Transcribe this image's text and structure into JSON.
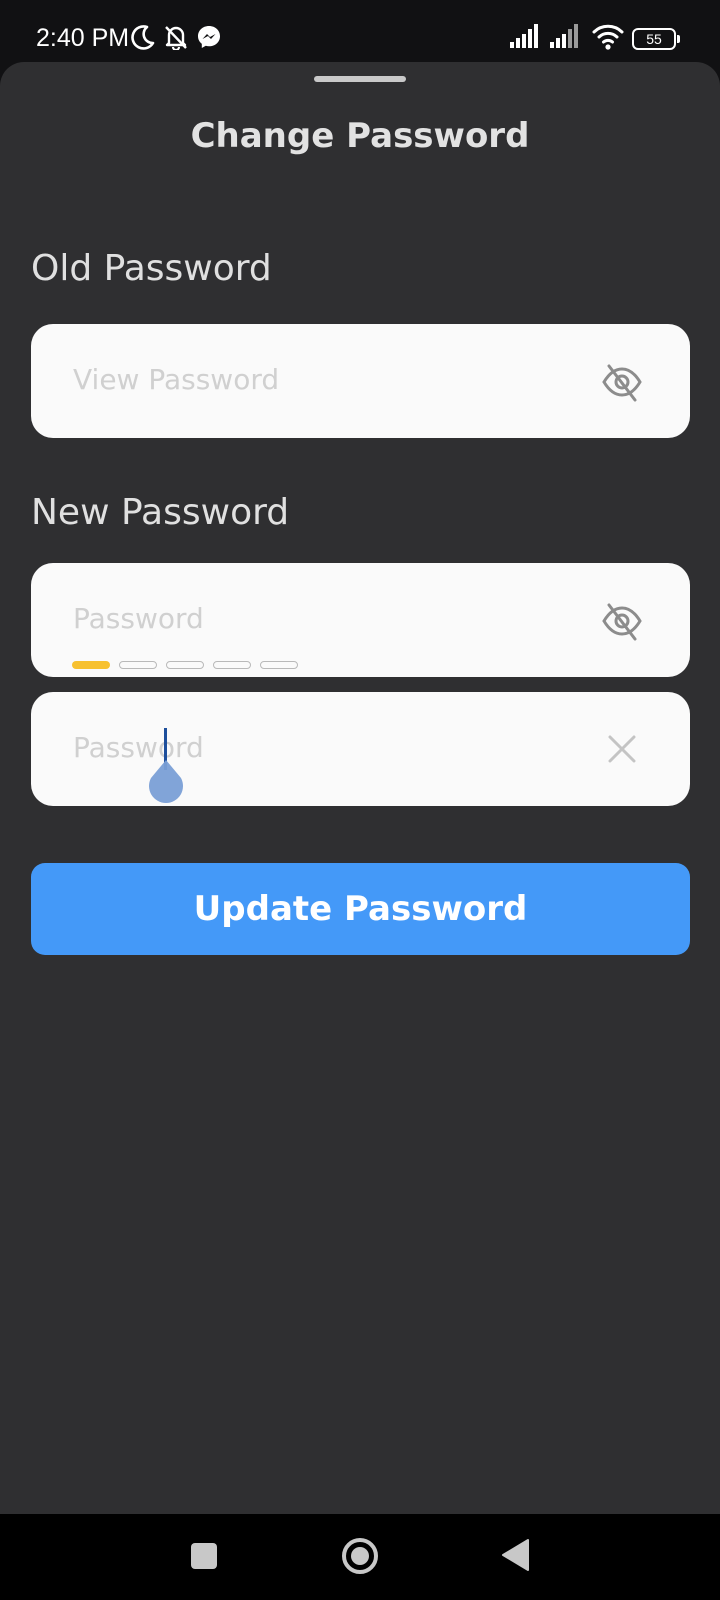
{
  "status_bar": {
    "time": "2:40 PM",
    "battery_level": "55",
    "icons": [
      "moon-icon",
      "bell-off-icon",
      "messenger-icon",
      "signal-icon",
      "signal-icon",
      "wifi-icon",
      "battery-icon"
    ]
  },
  "sheet": {
    "title": "Change Password"
  },
  "old_password": {
    "label": "Old Password",
    "placeholder": "View Password",
    "icon": "eye-off-icon"
  },
  "new_password": {
    "label": "New Password",
    "placeholder": "Password",
    "icon": "eye-off-icon",
    "strength": {
      "segments_filled": 1,
      "segments_total": 5,
      "color": "#f7c12f"
    }
  },
  "confirm_password": {
    "placeholder": "Password",
    "icon": "close-icon"
  },
  "update_button": {
    "label": "Update Password",
    "color": "#4499f8"
  },
  "nav_bar": {
    "icons": [
      "recent-apps-icon",
      "home-icon",
      "back-icon"
    ]
  }
}
